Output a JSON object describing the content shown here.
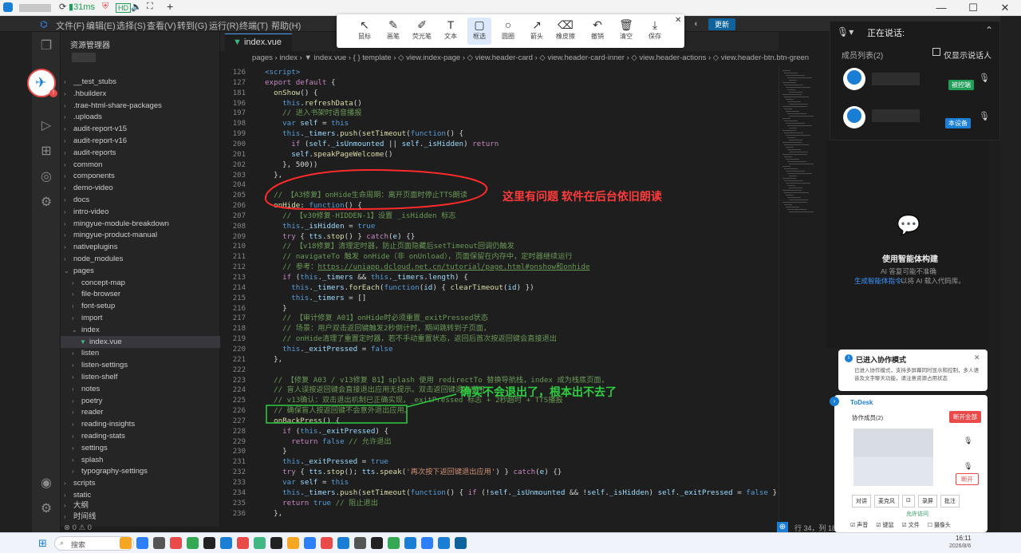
{
  "browser": {
    "tab_speed": "31ms",
    "new_tab": "+"
  },
  "window_controls": {
    "min": "—",
    "max": "☐",
    "close": "✕"
  },
  "menu": [
    "文件(F)",
    "编辑(E)",
    "选择(S)",
    "查看(V)",
    "转到(G)",
    "运行(R)",
    "终端(T)",
    "帮助(H)"
  ],
  "update_btn": "更新",
  "explorer": {
    "title": "资源管理器",
    "items": [
      {
        "label": "__test_stubs",
        "depth": 1,
        "open": false
      },
      {
        "label": ".hbuilderx",
        "depth": 1,
        "open": false
      },
      {
        "label": ".trae-html-share-packages",
        "depth": 1,
        "open": false
      },
      {
        "label": ".uploads",
        "depth": 1,
        "open": false
      },
      {
        "label": "audit-report-v15",
        "depth": 1,
        "open": false
      },
      {
        "label": "audit-report-v16",
        "depth": 1,
        "open": false
      },
      {
        "label": "audit-reports",
        "depth": 1,
        "open": false
      },
      {
        "label": "common",
        "depth": 1,
        "open": false
      },
      {
        "label": "components",
        "depth": 1,
        "open": false
      },
      {
        "label": "demo-video",
        "depth": 1,
        "open": false
      },
      {
        "label": "docs",
        "depth": 1,
        "open": false
      },
      {
        "label": "intro-video",
        "depth": 1,
        "open": false
      },
      {
        "label": "mingyue-module-breakdown",
        "depth": 1,
        "open": false
      },
      {
        "label": "mingyue-product-manual",
        "depth": 1,
        "open": false
      },
      {
        "label": "nativeplugins",
        "depth": 1,
        "open": false
      },
      {
        "label": "node_modules",
        "depth": 1,
        "open": false
      },
      {
        "label": "pages",
        "depth": 1,
        "open": true
      },
      {
        "label": "concept-map",
        "depth": 2,
        "open": false
      },
      {
        "label": "file-browser",
        "depth": 2,
        "open": false
      },
      {
        "label": "font-setup",
        "depth": 2,
        "open": false
      },
      {
        "label": "import",
        "depth": 2,
        "open": false
      },
      {
        "label": "index",
        "depth": 2,
        "open": true
      },
      {
        "label": "index.vue",
        "depth": 3,
        "file": true,
        "selected": true
      },
      {
        "label": "listen",
        "depth": 2,
        "open": false
      },
      {
        "label": "listen-settings",
        "depth": 2,
        "open": false
      },
      {
        "label": "listen-shelf",
        "depth": 2,
        "open": false
      },
      {
        "label": "notes",
        "depth": 2,
        "open": false
      },
      {
        "label": "poetry",
        "depth": 2,
        "open": false
      },
      {
        "label": "reader",
        "depth": 2,
        "open": false
      },
      {
        "label": "reading-insights",
        "depth": 2,
        "open": false
      },
      {
        "label": "reading-stats",
        "depth": 2,
        "open": false
      },
      {
        "label": "settings",
        "depth": 2,
        "open": false
      },
      {
        "label": "splash",
        "depth": 2,
        "open": false
      },
      {
        "label": "typography-settings",
        "depth": 2,
        "open": false
      },
      {
        "label": "scripts",
        "depth": 1,
        "open": false
      },
      {
        "label": "static",
        "depth": 1,
        "open": false
      }
    ],
    "sections": [
      "大纲",
      "时间线"
    ],
    "status": "⊗ 0 ⚠ 0"
  },
  "tab": {
    "label": "index.vue"
  },
  "breadcrumb": "pages › index › ▼ index.vue › { } template › ◇ view.index-page › ◇ view.header-card › ◇ view.header-card-inner › ◇ view.header-actions › ◇ view.header-btn.btn-green",
  "code_lines": [
    {
      "n": "126",
      "html": "<span class='kw'>&lt;script&gt;</span>"
    },
    {
      "n": "127",
      "html": "<span class='pu'>export default</span> {"
    },
    {
      "n": "181",
      "html": "  <span class='fn'>onShow</span>() {"
    },
    {
      "n": "196",
      "html": "    <span class='kw'>this</span>.<span class='fn'>refreshData</span>()"
    },
    {
      "n": "197",
      "html": "    <span class='cm'>// 进入书架时语音播报</span>"
    },
    {
      "n": "198",
      "html": "    <span class='kw'>var</span> <span class='vr'>self</span> = <span class='kw'>this</span>"
    },
    {
      "n": "199",
      "html": "    <span class='kw'>this</span>.<span class='vr'>_timers</span>.<span class='fn'>push</span>(<span class='fn'>setTimeout</span>(<span class='kw'>function</span>() {"
    },
    {
      "n": "200",
      "html": "      <span class='pu'>if</span> (<span class='vr'>self</span>.<span class='vr'>_isUnmounted</span> || <span class='vr'>self</span>.<span class='vr'>_isHidden</span>) <span class='pu'>return</span>"
    },
    {
      "n": "201",
      "html": "      <span class='vr'>self</span>.<span class='fn'>speakPageWelcome</span>()"
    },
    {
      "n": "202",
      "html": "    }, 500))"
    },
    {
      "n": "203",
      "html": "  },"
    },
    {
      "n": "204",
      "html": ""
    },
    {
      "n": "205",
      "html": "  <span class='cm'>// 【A3修复】onHide生命周期：离开页面时停止TTS朗读</span>"
    },
    {
      "n": "206",
      "html": "  <span class='fn'>onHide</span>: <span class='kw'>function</span>() {"
    },
    {
      "n": "207",
      "html": "    <span class='cm'>// 【v30修复-HIDDEN-1】设置 _isHidden 标志</span>"
    },
    {
      "n": "208",
      "html": "    <span class='kw'>this</span>.<span class='vr'>_isHidden</span> = <span class='kw'>true</span>"
    },
    {
      "n": "209",
      "html": "    <span class='pu'>try</span> { <span class='vr'>tts</span>.<span class='fn'>stop</span>() } <span class='pu'>catch</span>(<span class='vr'>e</span>) {}"
    },
    {
      "n": "210",
      "html": "    <span class='cm'>// 【v18修复】清理定时器，防止页面隐藏后setTimeout回调仍触发</span>"
    },
    {
      "n": "211",
      "html": "    <span class='cm'>// navigateTo 触发 onHide（非 onUnload），页面保留在内存中，定时器继续运行</span>"
    },
    {
      "n": "212",
      "html": "    <span class='cm'>// 参考：<u>https://uniapp.dcloud.net.cn/tutorial/page.html#onshow和onhide</u></span>"
    },
    {
      "n": "213",
      "html": "    <span class='pu'>if</span> (<span class='kw'>this</span>.<span class='vr'>_timers</span> &amp;&amp; <span class='kw'>this</span>.<span class='vr'>_timers</span>.<span class='vr'>length</span>) {"
    },
    {
      "n": "214",
      "html": "      <span class='kw'>this</span>.<span class='vr'>_timers</span>.<span class='fn'>forEach</span>(<span class='kw'>function</span>(<span class='vr'>id</span>) { <span class='fn'>clearTimeout</span>(<span class='vr'>id</span>) })"
    },
    {
      "n": "215",
      "html": "      <span class='kw'>this</span>.<span class='vr'>_timers</span> = []"
    },
    {
      "n": "216",
      "html": "    }"
    },
    {
      "n": "217",
      "html": "    <span class='cm'>// 【审计修复 A01】onHide时必须重置_exitPressed状态</span>"
    },
    {
      "n": "218",
      "html": "    <span class='cm'>// 场景：用户双击返回键触发2秒倒计时，期间跳转到子页面，</span>"
    },
    {
      "n": "219",
      "html": "    <span class='cm'>// onHide清理了重置定时器，若不手动重置状态，返回后首次按返回键会直接退出</span>"
    },
    {
      "n": "220",
      "html": "    <span class='kw'>this</span>.<span class='vr'>_exitPressed</span> = <span class='kw'>false</span>"
    },
    {
      "n": "221",
      "html": "  },"
    },
    {
      "n": "222",
      "html": ""
    },
    {
      "n": "223",
      "html": "  <span class='cm'>// 【修复 A03 / v13修复 B1】splash 使用 redirectTo 替换导航栈，index 成为栈底页面，</span>"
    },
    {
      "n": "224",
      "html": "  <span class='cm'>// 盲人误按返回键会直接退出应用无提示。双击返回键退出应用</span>"
    },
    {
      "n": "225",
      "html": "  <span class='cm'>// v13确认：双击退出机制已正确实现，_exitPressed 标志 + 2秒超时 + TTS播报</span>"
    },
    {
      "n": "226",
      "html": "  <span class='cm'>// 确保盲人按返回键不会意外退出应用。</span>"
    },
    {
      "n": "227",
      "html": "  <span class='fn'>onBackPress</span>() {"
    },
    {
      "n": "228",
      "html": "    <span class='pu'>if</span> (<span class='kw'>this</span>.<span class='vr'>_exitPressed</span>) {"
    },
    {
      "n": "229",
      "html": "      <span class='pu'>return</span> <span class='kw'>false</span> <span class='cm'>// 允许退出</span>"
    },
    {
      "n": "230",
      "html": "    }"
    },
    {
      "n": "231",
      "html": "    <span class='kw'>this</span>.<span class='vr'>_exitPressed</span> = <span class='kw'>true</span>"
    },
    {
      "n": "232",
      "html": "    <span class='pu'>try</span> { <span class='vr'>tts</span>.<span class='fn'>stop</span>(); <span class='vr'>tts</span>.<span class='fn'>speak</span>(<span class='str'>'再次按下返回键退出应用'</span>) } <span class='pu'>catch</span>(<span class='vr'>e</span>) {}"
    },
    {
      "n": "233",
      "html": "    <span class='kw'>var</span> <span class='vr'>self</span> = <span class='kw'>this</span>"
    },
    {
      "n": "234",
      "html": "    <span class='kw'>this</span>.<span class='vr'>_timers</span>.<span class='fn'>push</span>(<span class='fn'>setTimeout</span>(<span class='kw'>function</span>() { <span class='pu'>if</span> (!<span class='vr'>self</span>.<span class='vr'>_isUnmounted</span> &amp;&amp; !<span class='vr'>self</span>.<span class='vr'>_isHidden</span>) <span class='vr'>self</span>.<span class='vr'>_exitPressed</span> = <span class='kw'>false</span> }, 2000))"
    },
    {
      "n": "235",
      "html": "    <span class='pu'>return</span> <span class='kw'>true</span> <span class='cm'>// 阻止退出</span>"
    },
    {
      "n": "236",
      "html": "  },"
    }
  ],
  "drawbar": {
    "tools": [
      {
        "label": "鼠标",
        "icon": "↖"
      },
      {
        "label": "画笔",
        "icon": "✎"
      },
      {
        "label": "荧光笔",
        "icon": "✐"
      },
      {
        "label": "文本",
        "icon": "T"
      },
      {
        "label": "框选",
        "icon": "▢",
        "active": true
      },
      {
        "label": "圆圈",
        "icon": "○"
      },
      {
        "label": "箭头",
        "icon": "↗"
      },
      {
        "label": "橡皮擦",
        "icon": "⌫"
      },
      {
        "label": "撤销",
        "icon": "↶"
      },
      {
        "label": "清空",
        "icon": "🗑"
      },
      {
        "label": "保存",
        "icon": "⤓"
      }
    ],
    "close": "✕"
  },
  "annotations": {
    "red": "这里有问题  软件在后台依旧朗读",
    "green": "确实不会退出了，根本出不去了"
  },
  "voice": {
    "title": "正在说话:",
    "members_label": "成员列表(2)",
    "only_speaking": "仅显示说话人",
    "members": [
      {
        "badge": "被控端"
      },
      {
        "badge": "本设备"
      }
    ]
  },
  "ai": {
    "title": "使用智能体构建",
    "line1": "AI 答复可能不准确",
    "link": "生成智能体指令",
    "line2": "以将 AI 载入代码库。"
  },
  "statusbar": {
    "pos": "行 34，列 18"
  },
  "collab": {
    "title": "已进入协作模式",
    "body": "已进入协作模式，支持多屏幕同时显示和控制，多人语音及文字聊天功能，请注意资源占用状态",
    "close": "✕"
  },
  "todesk": {
    "brand": "ToDesk",
    "members_label": "协作成员(2)",
    "leave_all": "断开全部",
    "disconnect": "断开",
    "buttons": [
      "对讲",
      "麦克风",
      "⊡",
      "录屏",
      "批注"
    ],
    "allow": "允许访问",
    "perms": [
      "声音",
      "键鼠",
      "文件",
      "摄像头"
    ]
  },
  "taskbar": {
    "search": "搜索",
    "time": "16:11",
    "date": "2026/8/6"
  },
  "colors": {
    "accent": "#3794ff",
    "annotation_red": "#ff3b3b",
    "annotation_green": "#2ecc40",
    "badge_blue": "#1a7fd4",
    "badge_green": "#1e9e57",
    "todesk_red": "#e94b4b"
  }
}
